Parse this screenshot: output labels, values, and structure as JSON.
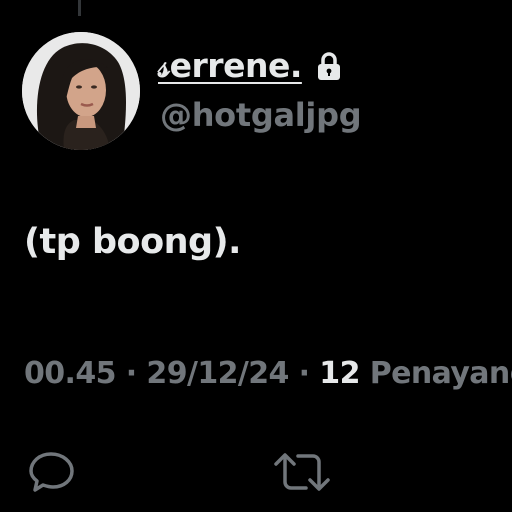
{
  "tweet": {
    "display_name": "𝓈errene.",
    "handle": "@hotgaljpg",
    "text": "(tp boong).",
    "time": "00.45",
    "separator": "·",
    "date": "29/12/24",
    "views_count": "12",
    "views_label": "Penayangan"
  },
  "icons": {
    "lock": "lock-icon",
    "reply": "reply-icon",
    "retweet": "retweet-icon"
  },
  "colors": {
    "background": "#000000",
    "primary_text": "#e7e9ea",
    "secondary_text": "#71767b"
  }
}
